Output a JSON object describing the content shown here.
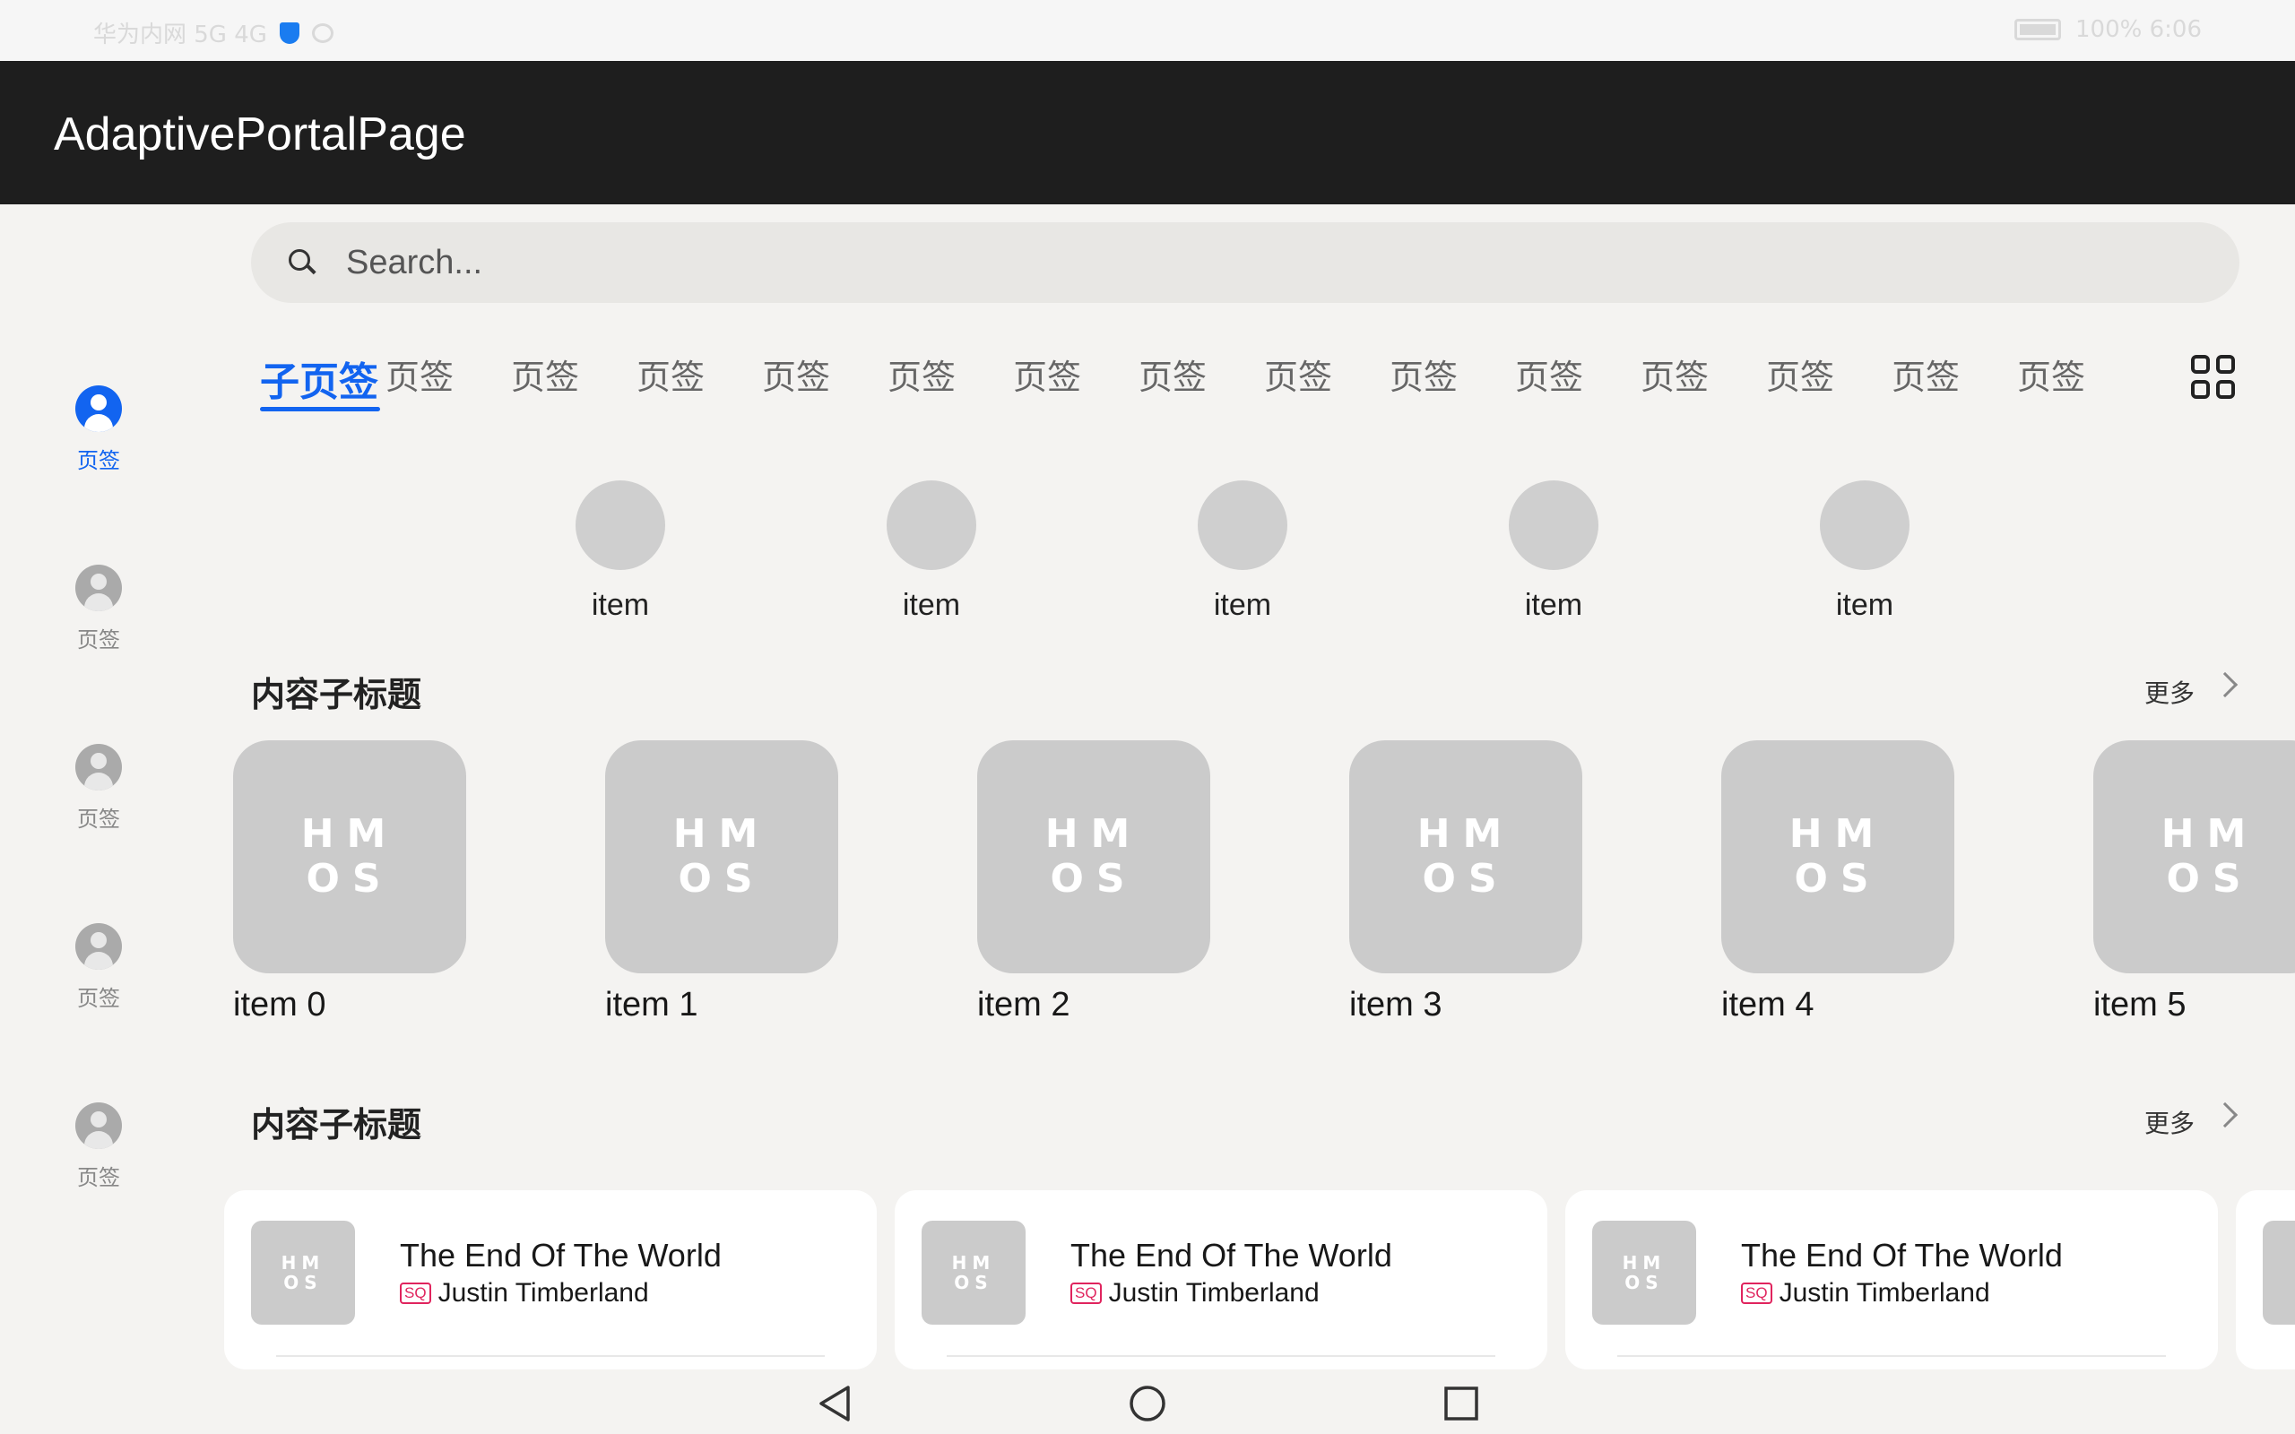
{
  "status_bar": {
    "left_text": "华为内网 5G 4G",
    "right_text": "100% 6:06"
  },
  "app_bar": {
    "title": "AdaptivePortalPage"
  },
  "rail": {
    "items": [
      {
        "label": "页签",
        "active": true
      },
      {
        "label": "页签",
        "active": false
      },
      {
        "label": "页签",
        "active": false
      },
      {
        "label": "页签",
        "active": false
      },
      {
        "label": "页签",
        "active": false
      }
    ]
  },
  "search": {
    "placeholder": "Search...",
    "value": ""
  },
  "tabs": {
    "items": [
      {
        "label": "子页签",
        "active": true
      },
      {
        "label": "页签"
      },
      {
        "label": "页签"
      },
      {
        "label": "页签"
      },
      {
        "label": "页签"
      },
      {
        "label": "页签"
      },
      {
        "label": "页签"
      },
      {
        "label": "页签"
      },
      {
        "label": "页签"
      },
      {
        "label": "页签"
      },
      {
        "label": "页签"
      },
      {
        "label": "页签"
      },
      {
        "label": "页签"
      },
      {
        "label": "页签"
      },
      {
        "label": "页签"
      }
    ],
    "grid_icon": "grid-icon"
  },
  "circle_items": [
    {
      "label": "item"
    },
    {
      "label": "item"
    },
    {
      "label": "item"
    },
    {
      "label": "item"
    },
    {
      "label": "item"
    }
  ],
  "section1": {
    "title": "内容子标题",
    "more": "更多"
  },
  "tiles": {
    "logo_line1": "HM",
    "logo_line2": "OS",
    "items": [
      {
        "label": "item 0"
      },
      {
        "label": "item 1"
      },
      {
        "label": "item 2"
      },
      {
        "label": "item 3"
      },
      {
        "label": "item 4"
      },
      {
        "label": "item 5"
      }
    ]
  },
  "section2": {
    "title": "内容子标题",
    "more": "更多"
  },
  "cards": {
    "logo_line1": "HM",
    "logo_line2": "OS",
    "items": [
      {
        "song": "The End Of The World",
        "badge": "SQ",
        "artist": "Justin Timberland"
      },
      {
        "song": "The End Of The World",
        "badge": "SQ",
        "artist": "Justin Timberland"
      },
      {
        "song": "The End Of The World",
        "badge": "SQ",
        "artist": "Justin Timberland"
      }
    ]
  },
  "colors": {
    "accent": "#1264f0",
    "appbar": "#1e1e1e",
    "badge": "#e0245e"
  }
}
